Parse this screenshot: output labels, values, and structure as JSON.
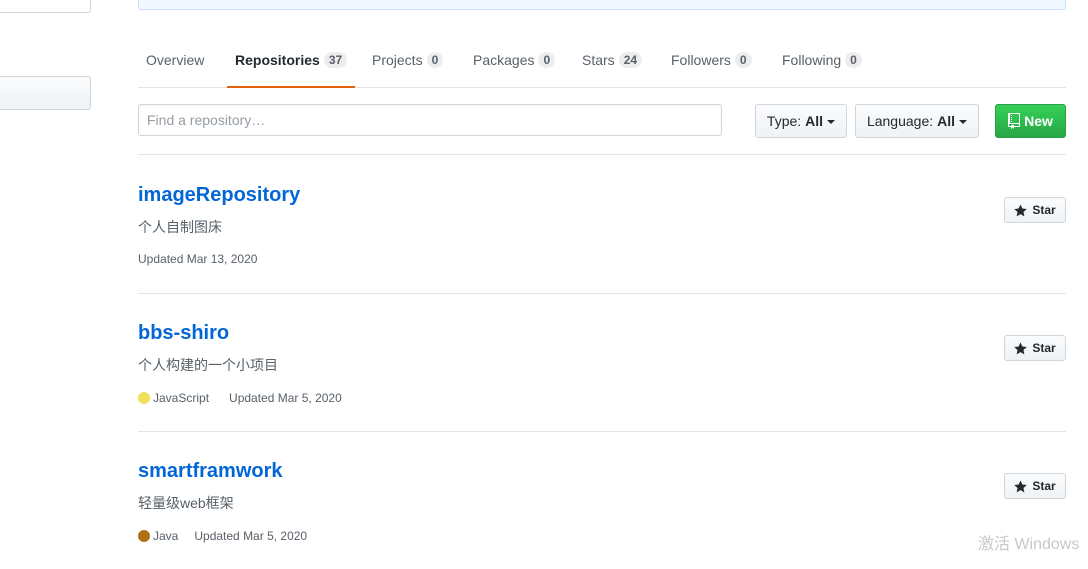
{
  "colors": {
    "link": "#0366d6",
    "tab_underline": "#e36209",
    "new_button": "#28a745",
    "javascript": "#f1e05a",
    "java": "#b07219"
  },
  "tabs": [
    {
      "label": "Overview",
      "count": null
    },
    {
      "label": "Repositories",
      "count": "37"
    },
    {
      "label": "Projects",
      "count": "0"
    },
    {
      "label": "Packages",
      "count": "0"
    },
    {
      "label": "Stars",
      "count": "24"
    },
    {
      "label": "Followers",
      "count": "0"
    },
    {
      "label": "Following",
      "count": "0"
    }
  ],
  "selected_tab": "Repositories",
  "filter": {
    "search_placeholder": "Find a repository…",
    "search_value": "",
    "type_label": "Type:",
    "type_value": "All",
    "language_label": "Language:",
    "language_value": "All",
    "new_label": "New",
    "new_icon": "repo-icon"
  },
  "repos": [
    {
      "name": "imageRepository",
      "description": "个人自制图床",
      "language": "",
      "updated": "Updated Mar 13, 2020",
      "star_label": "Star"
    },
    {
      "name": "bbs-shiro",
      "description": "个人构建的一个小项目",
      "language": "JavaScript",
      "updated": "Updated Mar 5, 2020",
      "star_label": "Star"
    },
    {
      "name": "smartframwork",
      "description": "轻量级web框架",
      "language": "Java",
      "updated": "Updated Mar 5, 2020",
      "star_label": "Star"
    }
  ],
  "watermark": "激活 Windows"
}
